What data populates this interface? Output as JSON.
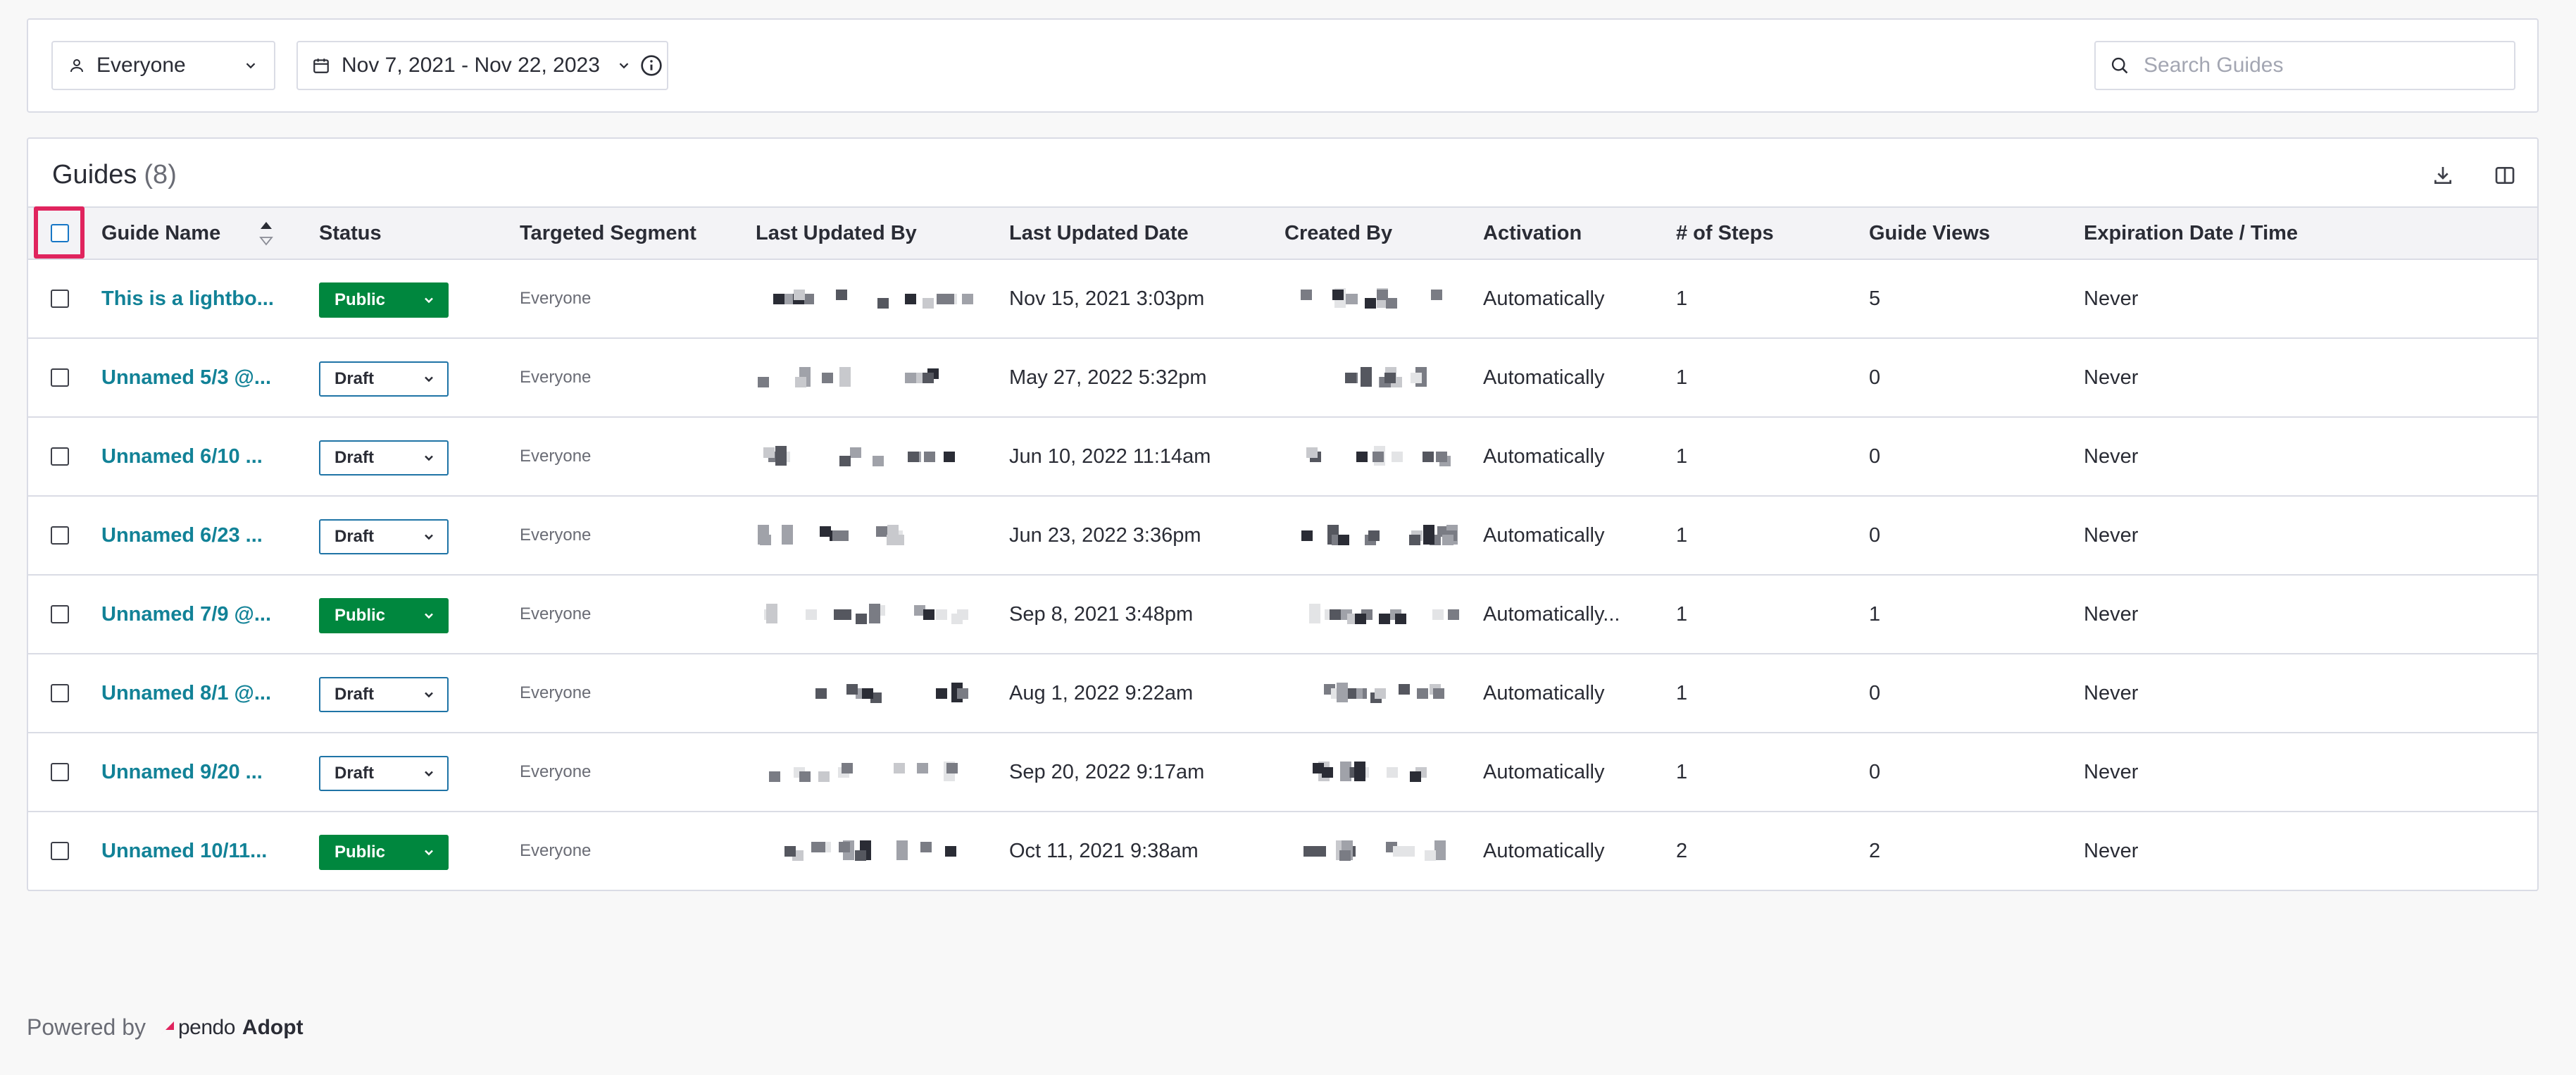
{
  "filters": {
    "segment": "Everyone",
    "date_range": "Nov 7, 2021 - Nov 22, 2023",
    "search_placeholder": "Search Guides"
  },
  "panel": {
    "title": "Guides",
    "count": "(8)"
  },
  "columns": {
    "name": "Guide Name",
    "status": "Status",
    "segment": "Targeted Segment",
    "updated_by": "Last Updated By",
    "updated_date": "Last Updated Date",
    "created_by": "Created By",
    "activation": "Activation",
    "steps": "# of Steps",
    "views": "Guide Views",
    "expiration": "Expiration Date / Time"
  },
  "rows": [
    {
      "name": "This is a lightbo...",
      "status": "Public",
      "segment": "Everyone",
      "updated_date": "Nov 15, 2021 3:03pm",
      "activation": "Automatically",
      "steps": "1",
      "views": "5",
      "expiration": "Never"
    },
    {
      "name": "Unnamed 5/3 @...",
      "status": "Draft",
      "segment": "Everyone",
      "updated_date": "May 27, 2022 5:32pm",
      "activation": "Automatically",
      "steps": "1",
      "views": "0",
      "expiration": "Never"
    },
    {
      "name": "Unnamed 6/10 ...",
      "status": "Draft",
      "segment": "Everyone",
      "updated_date": "Jun 10, 2022 11:14am",
      "activation": "Automatically",
      "steps": "1",
      "views": "0",
      "expiration": "Never"
    },
    {
      "name": "Unnamed 6/23 ...",
      "status": "Draft",
      "segment": "Everyone",
      "updated_date": "Jun 23, 2022 3:36pm",
      "activation": "Automatically",
      "steps": "1",
      "views": "0",
      "expiration": "Never"
    },
    {
      "name": "Unnamed 7/9 @...",
      "status": "Public",
      "segment": "Everyone",
      "updated_date": "Sep 8, 2021 3:48pm",
      "activation": "Automatically...",
      "steps": "1",
      "views": "1",
      "expiration": "Never"
    },
    {
      "name": "Unnamed 8/1 @...",
      "status": "Draft",
      "segment": "Everyone",
      "updated_date": "Aug 1, 2022 9:22am",
      "activation": "Automatically",
      "steps": "1",
      "views": "0",
      "expiration": "Never"
    },
    {
      "name": "Unnamed 9/20 ...",
      "status": "Draft",
      "segment": "Everyone",
      "updated_date": "Sep 20, 2022 9:17am",
      "activation": "Automatically",
      "steps": "1",
      "views": "0",
      "expiration": "Never"
    },
    {
      "name": "Unnamed 10/11...",
      "status": "Public",
      "segment": "Everyone",
      "updated_date": "Oct 11, 2021 9:38am",
      "activation": "Automatically",
      "steps": "2",
      "views": "2",
      "expiration": "Never"
    }
  ],
  "footer": {
    "powered_by": "Powered by",
    "brand": "pendo",
    "product": "Adopt"
  },
  "colors": {
    "accent_link": "#128297",
    "public": "#00873e",
    "draft_border": "#1f74a6",
    "highlight": "#e0245e"
  }
}
